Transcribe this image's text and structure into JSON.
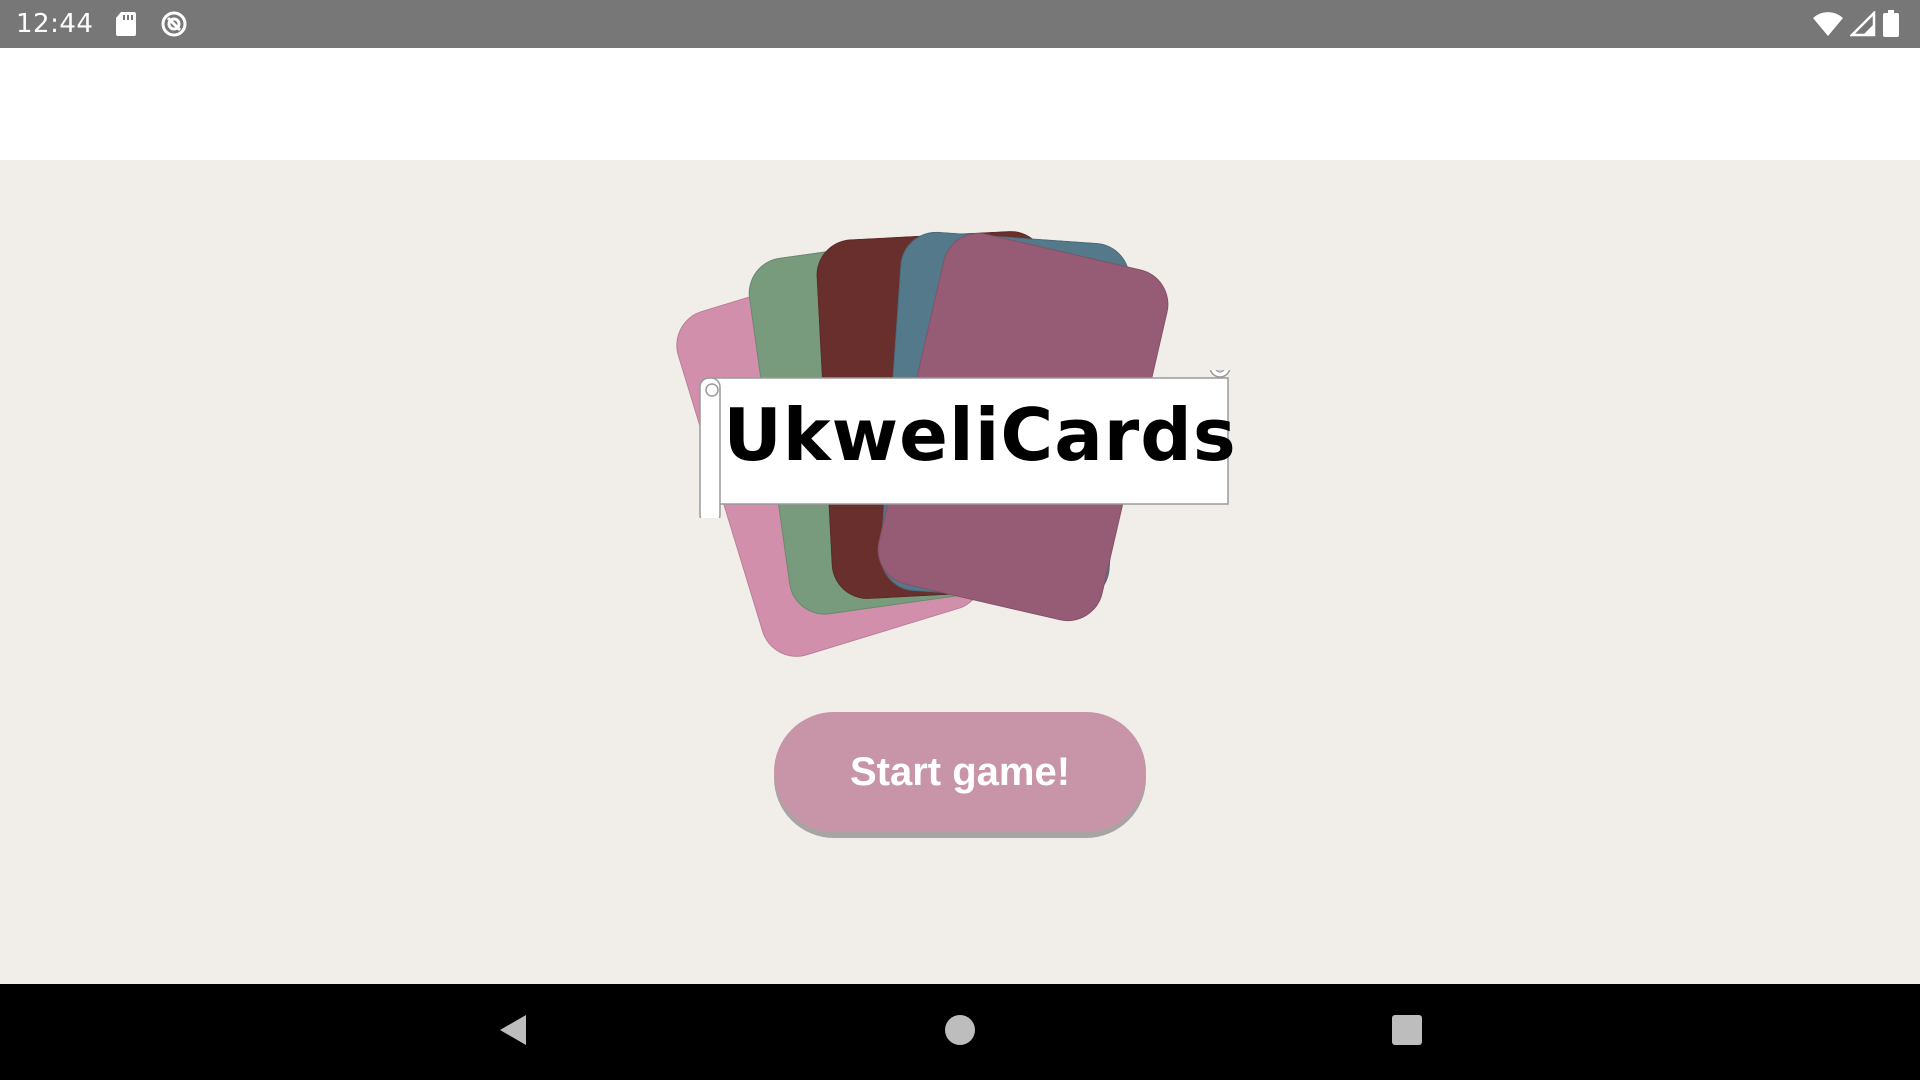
{
  "status_bar": {
    "time": "12:44",
    "left_icons": [
      "sd-card-icon",
      "data-saver-icon"
    ],
    "right_icons": [
      "wifi-icon",
      "signal-icon",
      "battery-icon"
    ]
  },
  "app_bar": {},
  "logo": {
    "title": "UkweliCards",
    "card_colors": [
      "#d28fab",
      "#789b7e",
      "#692f2c",
      "#54798b",
      "#965c75"
    ],
    "banner_color": "#ffffff"
  },
  "main": {
    "start_button_label": "Start game!",
    "start_button_color": "#c894a7"
  },
  "nav_bar": {
    "buttons": [
      "back-icon",
      "home-icon",
      "recents-icon"
    ]
  }
}
